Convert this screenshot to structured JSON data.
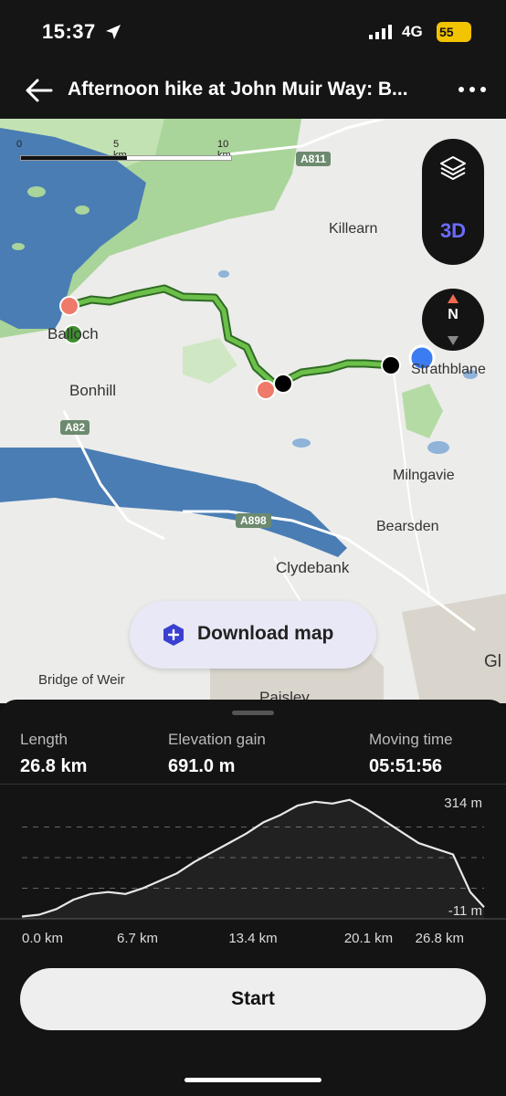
{
  "status": {
    "time": "15:37",
    "network": "4G",
    "battery": "55"
  },
  "header": {
    "title": "Afternoon hike at John Muir Way: B..."
  },
  "map": {
    "scale": {
      "zero": "0",
      "mid": "5 km",
      "max": "10 km"
    },
    "places": {
      "killearn": "Killearn",
      "balloch": "Balloch",
      "bonhill": "Bonhill",
      "strathblane": "Strathblane",
      "milngavie": "Milngavie",
      "bearsden": "Bearsden",
      "clydebank": "Clydebank",
      "bridge_of_weir": "Bridge of Weir",
      "paisley": "Paisley",
      "glasgow": "Gl"
    },
    "roads": {
      "a811": "A811",
      "a82": "A82",
      "a898": "A898"
    },
    "mode_3d": "3D",
    "compass": "N",
    "download_label": "Download map",
    "route_color": "#6cc04a"
  },
  "stats": {
    "length_label": "Length",
    "length_value": "26.8 km",
    "elevation_label": "Elevation gain",
    "elevation_value": "691.0 m",
    "moving_label": "Moving time",
    "moving_value": "05:51:56"
  },
  "chart_data": {
    "type": "area",
    "x_unit": "km",
    "y_unit": "m",
    "ylim": [
      -11,
      314
    ],
    "xlim": [
      0,
      26.8
    ],
    "x_tick_labels": [
      "0.0 km",
      "6.7 km",
      "13.4 km",
      "20.1 km",
      "26.8 km"
    ],
    "y_tick_labels": [
      "314 m",
      "-11 m"
    ],
    "x": [
      0,
      1,
      2,
      3,
      4,
      5,
      6,
      7,
      8,
      9,
      10,
      11,
      12,
      13,
      14,
      15,
      16,
      17,
      18,
      19,
      20,
      21,
      22,
      23,
      24,
      25,
      26,
      26.8
    ],
    "y": [
      -5,
      0,
      15,
      40,
      55,
      60,
      55,
      70,
      90,
      110,
      140,
      165,
      190,
      215,
      245,
      265,
      290,
      300,
      295,
      305,
      280,
      250,
      220,
      190,
      175,
      160,
      60,
      20
    ]
  },
  "actions": {
    "start_label": "Start"
  }
}
